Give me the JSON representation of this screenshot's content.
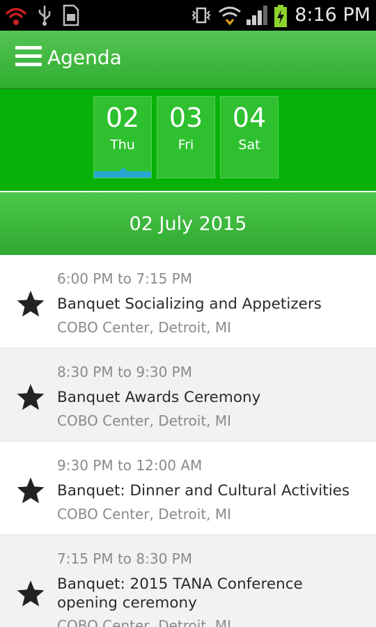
{
  "status_bar": {
    "time": "8:16 PM"
  },
  "app_bar": {
    "title": "Agenda"
  },
  "days": [
    {
      "num": "02",
      "dow": "Thu",
      "selected": true
    },
    {
      "num": "03",
      "dow": "Fri",
      "selected": false
    },
    {
      "num": "04",
      "dow": "Sat",
      "selected": false
    }
  ],
  "date_header": "02 July 2015",
  "events": [
    {
      "time": "6:00 PM to 7:15 PM",
      "title": "Banquet Socializing and Appetizers",
      "location": "COBO Center, Detroit, MI"
    },
    {
      "time": "8:30 PM to 9:30 PM",
      "title": "Banquet Awards Ceremony",
      "location": "COBO Center, Detroit, MI"
    },
    {
      "time": "9:30 PM to 12:00 AM",
      "title": "Banquet: Dinner and Cultural Activities",
      "location": "COBO Center, Detroit, MI"
    },
    {
      "time": "7:15 PM to 8:30 PM",
      "title": "Banquet: 2015 TANA Conference opening ceremony",
      "location": "COBO Center, Detroit, MI"
    }
  ],
  "colors": {
    "primary_green": "#08b108",
    "selected_indicator": "#26a6d1"
  }
}
